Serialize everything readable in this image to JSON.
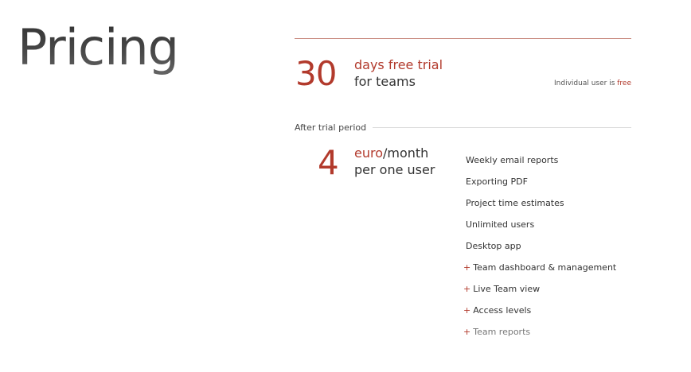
{
  "page": {
    "title": "Pricing"
  },
  "trial": {
    "number": "30",
    "line1": "days free trial",
    "line2": "for teams",
    "individual_prefix": "Individual user is ",
    "individual_free": "free"
  },
  "after_trial": {
    "label": "After trial period"
  },
  "price": {
    "number": "4",
    "unit": "euro",
    "per": "/month",
    "line2": "per one user"
  },
  "features": [
    {
      "plus": "",
      "label": "Weekly email reports"
    },
    {
      "plus": "",
      "label": "Exporting PDF"
    },
    {
      "plus": "",
      "label": "Project time estimates"
    },
    {
      "plus": "",
      "label": "Unlimited users"
    },
    {
      "plus": "",
      "label": "Desktop app"
    },
    {
      "plus": "+",
      "label": "Team dashboard & management"
    },
    {
      "plus": "+",
      "label": "Live Team view"
    },
    {
      "plus": "+",
      "label": "Access levels"
    },
    {
      "plus": "+",
      "label": "Team reports"
    }
  ],
  "colors": {
    "accent": "#b23a2c",
    "text": "#333333",
    "rule": "#c98a80"
  }
}
